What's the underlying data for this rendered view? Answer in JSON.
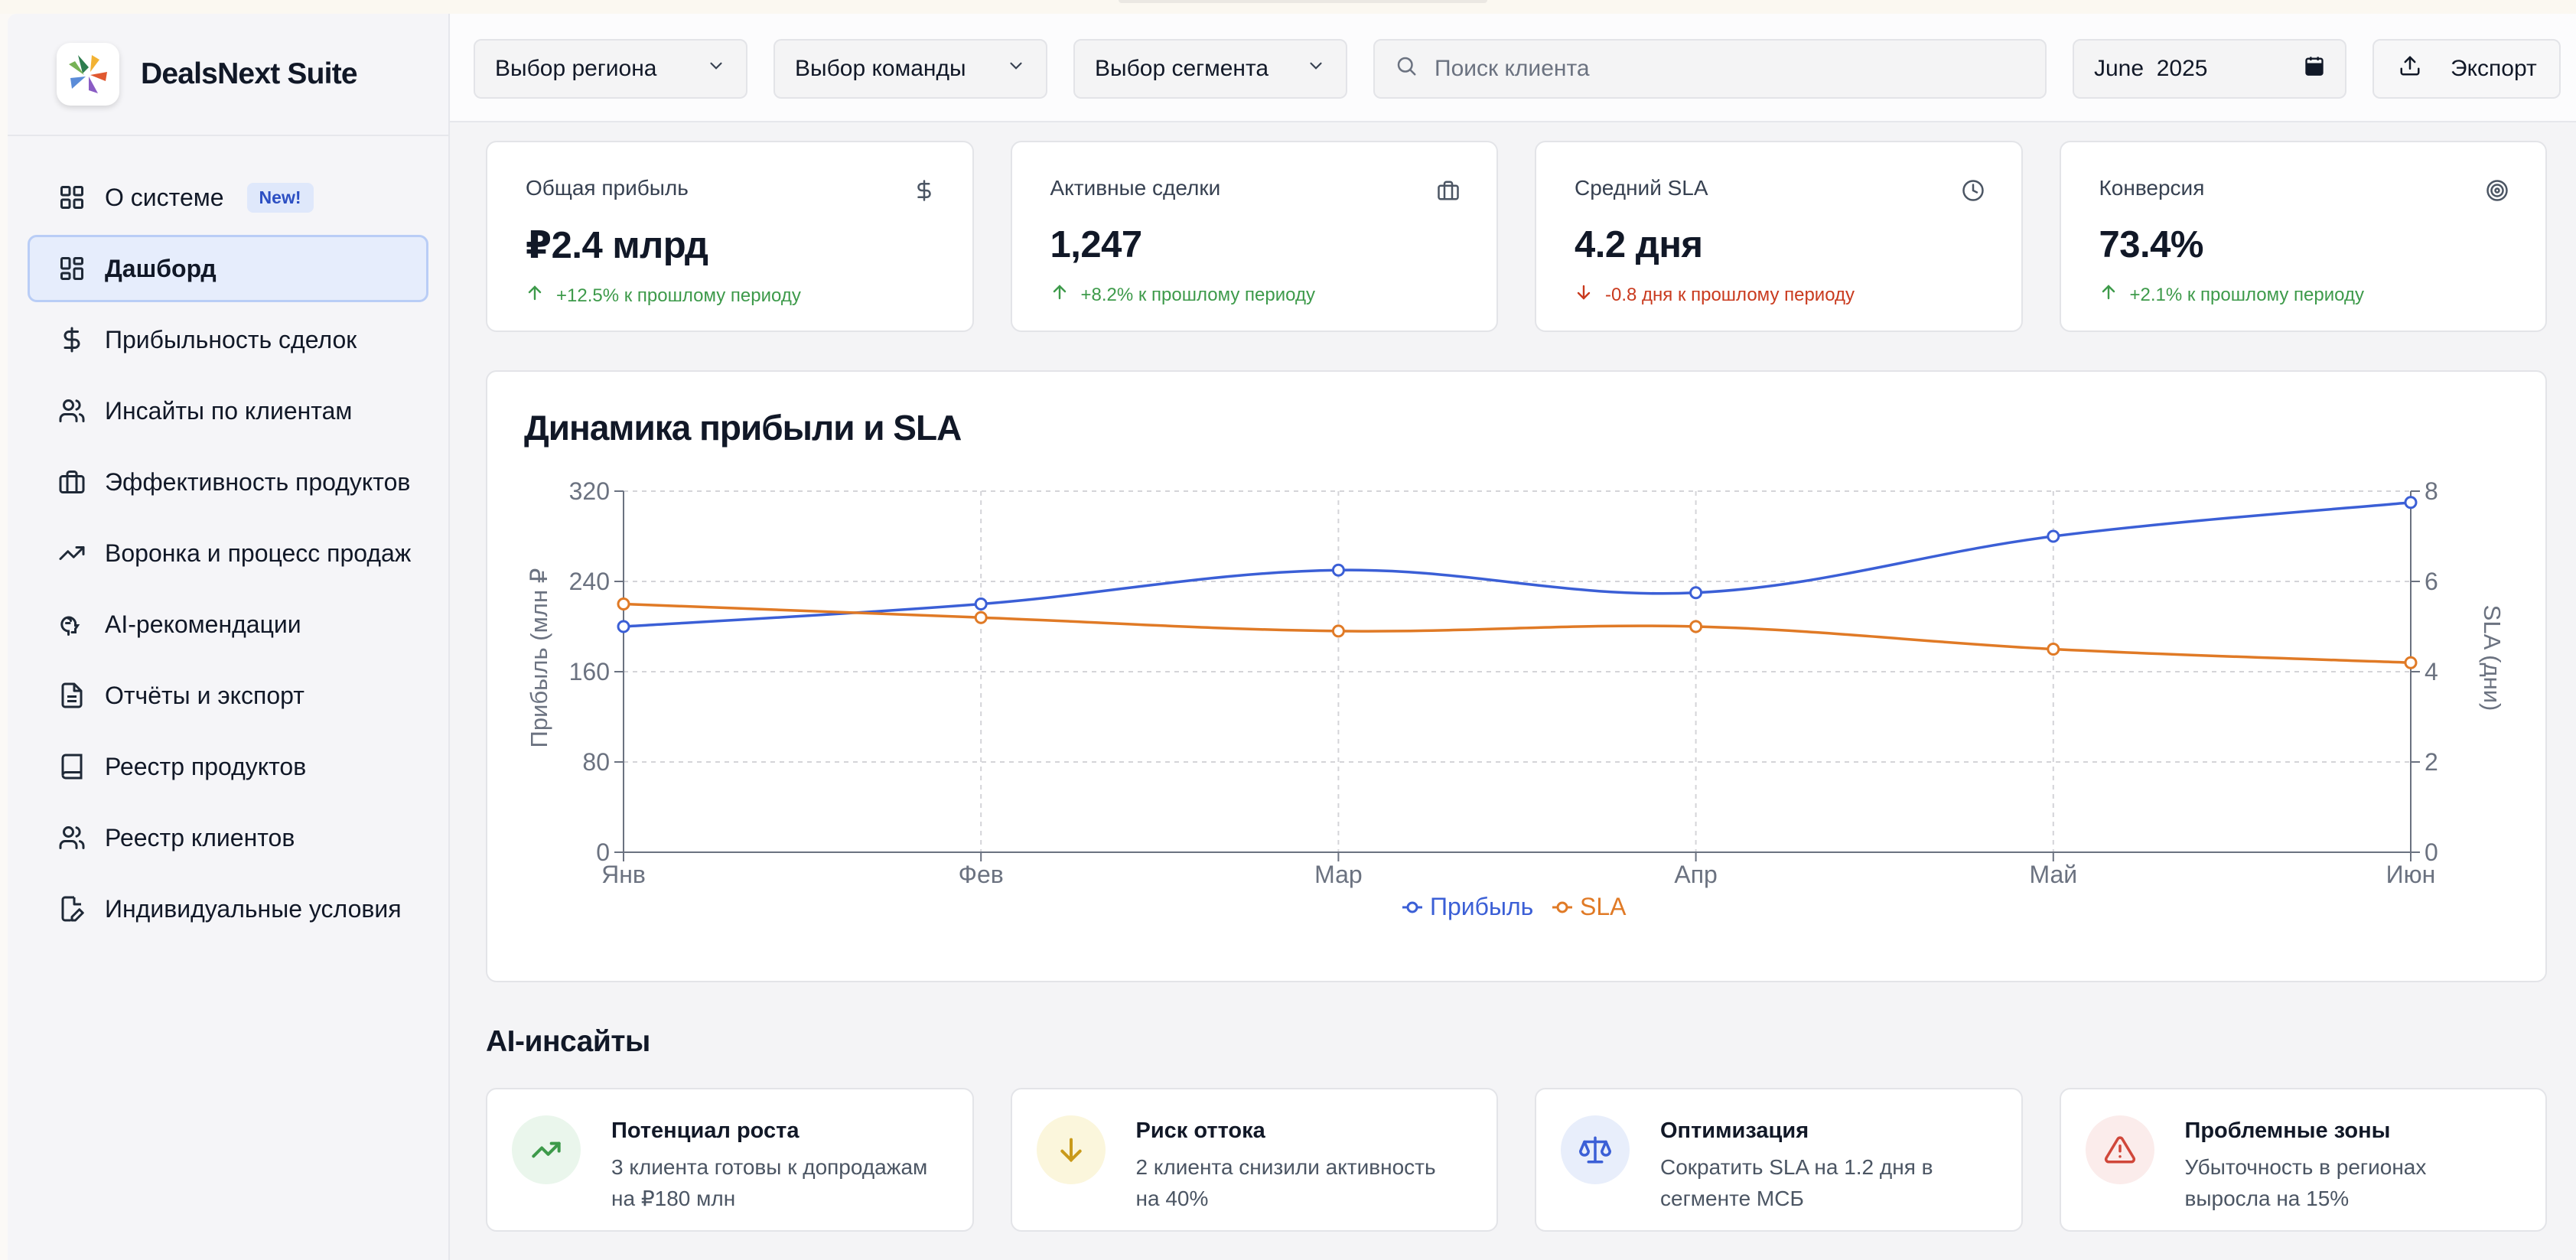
{
  "app": {
    "name": "DealsNext Suite"
  },
  "sidebar": {
    "items": [
      {
        "label": "О системе",
        "badge": "New!",
        "icon": "grid-icon"
      },
      {
        "label": "Дашборд",
        "icon": "dashboard-icon",
        "active": true
      },
      {
        "label": "Прибыльность сделок",
        "icon": "dollar-icon"
      },
      {
        "label": "Инсайты по клиентам",
        "icon": "users-icon"
      },
      {
        "label": "Эффективность продуктов",
        "icon": "briefcase-icon"
      },
      {
        "label": "Воронка и процесс продаж",
        "icon": "trending-up-icon"
      },
      {
        "label": "AI-рекомендации",
        "icon": "brain-icon"
      },
      {
        "label": "Отчёты и экспорт",
        "icon": "document-icon"
      },
      {
        "label": "Реестр продуктов",
        "icon": "book-icon"
      },
      {
        "label": "Реестр клиентов",
        "icon": "users-icon"
      },
      {
        "label": "Индивидуальные условия",
        "icon": "file-edit-icon"
      }
    ]
  },
  "toolbar": {
    "region": "Выбор региона",
    "team": "Выбор команды",
    "segment": "Выбор сегмента",
    "search_placeholder": "Поиск клиента",
    "date": "June  2025",
    "export": "Экспорт"
  },
  "kpis": [
    {
      "title": "Общая прибыль",
      "value": "₽2.4 млрд",
      "delta": "+12.5% к прошлому периоду",
      "trend": "up",
      "icon": "dollar-icon"
    },
    {
      "title": "Активные сделки",
      "value": "1,247",
      "delta": "+8.2% к прошлому периоду",
      "trend": "up",
      "icon": "briefcase-icon"
    },
    {
      "title": "Средний SLA",
      "value": "4.2 дня",
      "delta": "-0.8 дня к прошлому периоду",
      "trend": "down",
      "icon": "clock-icon"
    },
    {
      "title": "Конверсия",
      "value": "73.4%",
      "delta": "+2.1% к прошлому периоду",
      "trend": "up",
      "icon": "target-icon"
    }
  ],
  "colors": {
    "profit": "#3b5fd6",
    "sla": "#e07a26",
    "up": "#3d9a4a",
    "down": "#c93a1e"
  },
  "chart_data": {
    "type": "line",
    "title": "Динамика прибыли и SLA",
    "categories": [
      "Янв",
      "Фев",
      "Мар",
      "Апр",
      "Май",
      "Июн"
    ],
    "y_left": {
      "label": "Прибыль (млн ₽",
      "ticks": [
        "0",
        "80",
        "160",
        "240",
        "320"
      ],
      "range": [
        0,
        320
      ]
    },
    "y_right": {
      "label": "SLA (дни)",
      "ticks": [
        "0",
        "2",
        "4",
        "6",
        "8"
      ],
      "range": [
        0,
        8
      ]
    },
    "series": [
      {
        "name": "Прибыль",
        "axis": "left",
        "color": "#3b5fd6",
        "values": [
          200,
          220,
          250,
          230,
          280,
          310
        ]
      },
      {
        "name": "SLA",
        "axis": "right",
        "color": "#e07a26",
        "values": [
          5.5,
          5.2,
          4.9,
          5.0,
          4.5,
          4.2
        ]
      }
    ],
    "grid": true,
    "legend": "bottom-center"
  },
  "insights": {
    "title": "AI-инсайты",
    "items": [
      {
        "title": "Потенциал роста",
        "lines": [
          "3 клиента готовы к допродажам",
          "на ₽180 млн"
        ],
        "icon": "trending-up-icon"
      },
      {
        "title": "Риск оттока",
        "lines": [
          "2 клиента снизили активность",
          "на 40%"
        ],
        "icon": "arrow-down-icon"
      },
      {
        "title": "Оптимизация",
        "lines": [
          "Сократить SLA на 1.2 дня в",
          "сегменте МСБ"
        ],
        "icon": "scale-icon"
      },
      {
        "title": "Проблемные зоны",
        "lines": [
          "Убыточность в регионах",
          "выросла на 15%"
        ],
        "icon": "warning-icon"
      }
    ]
  }
}
